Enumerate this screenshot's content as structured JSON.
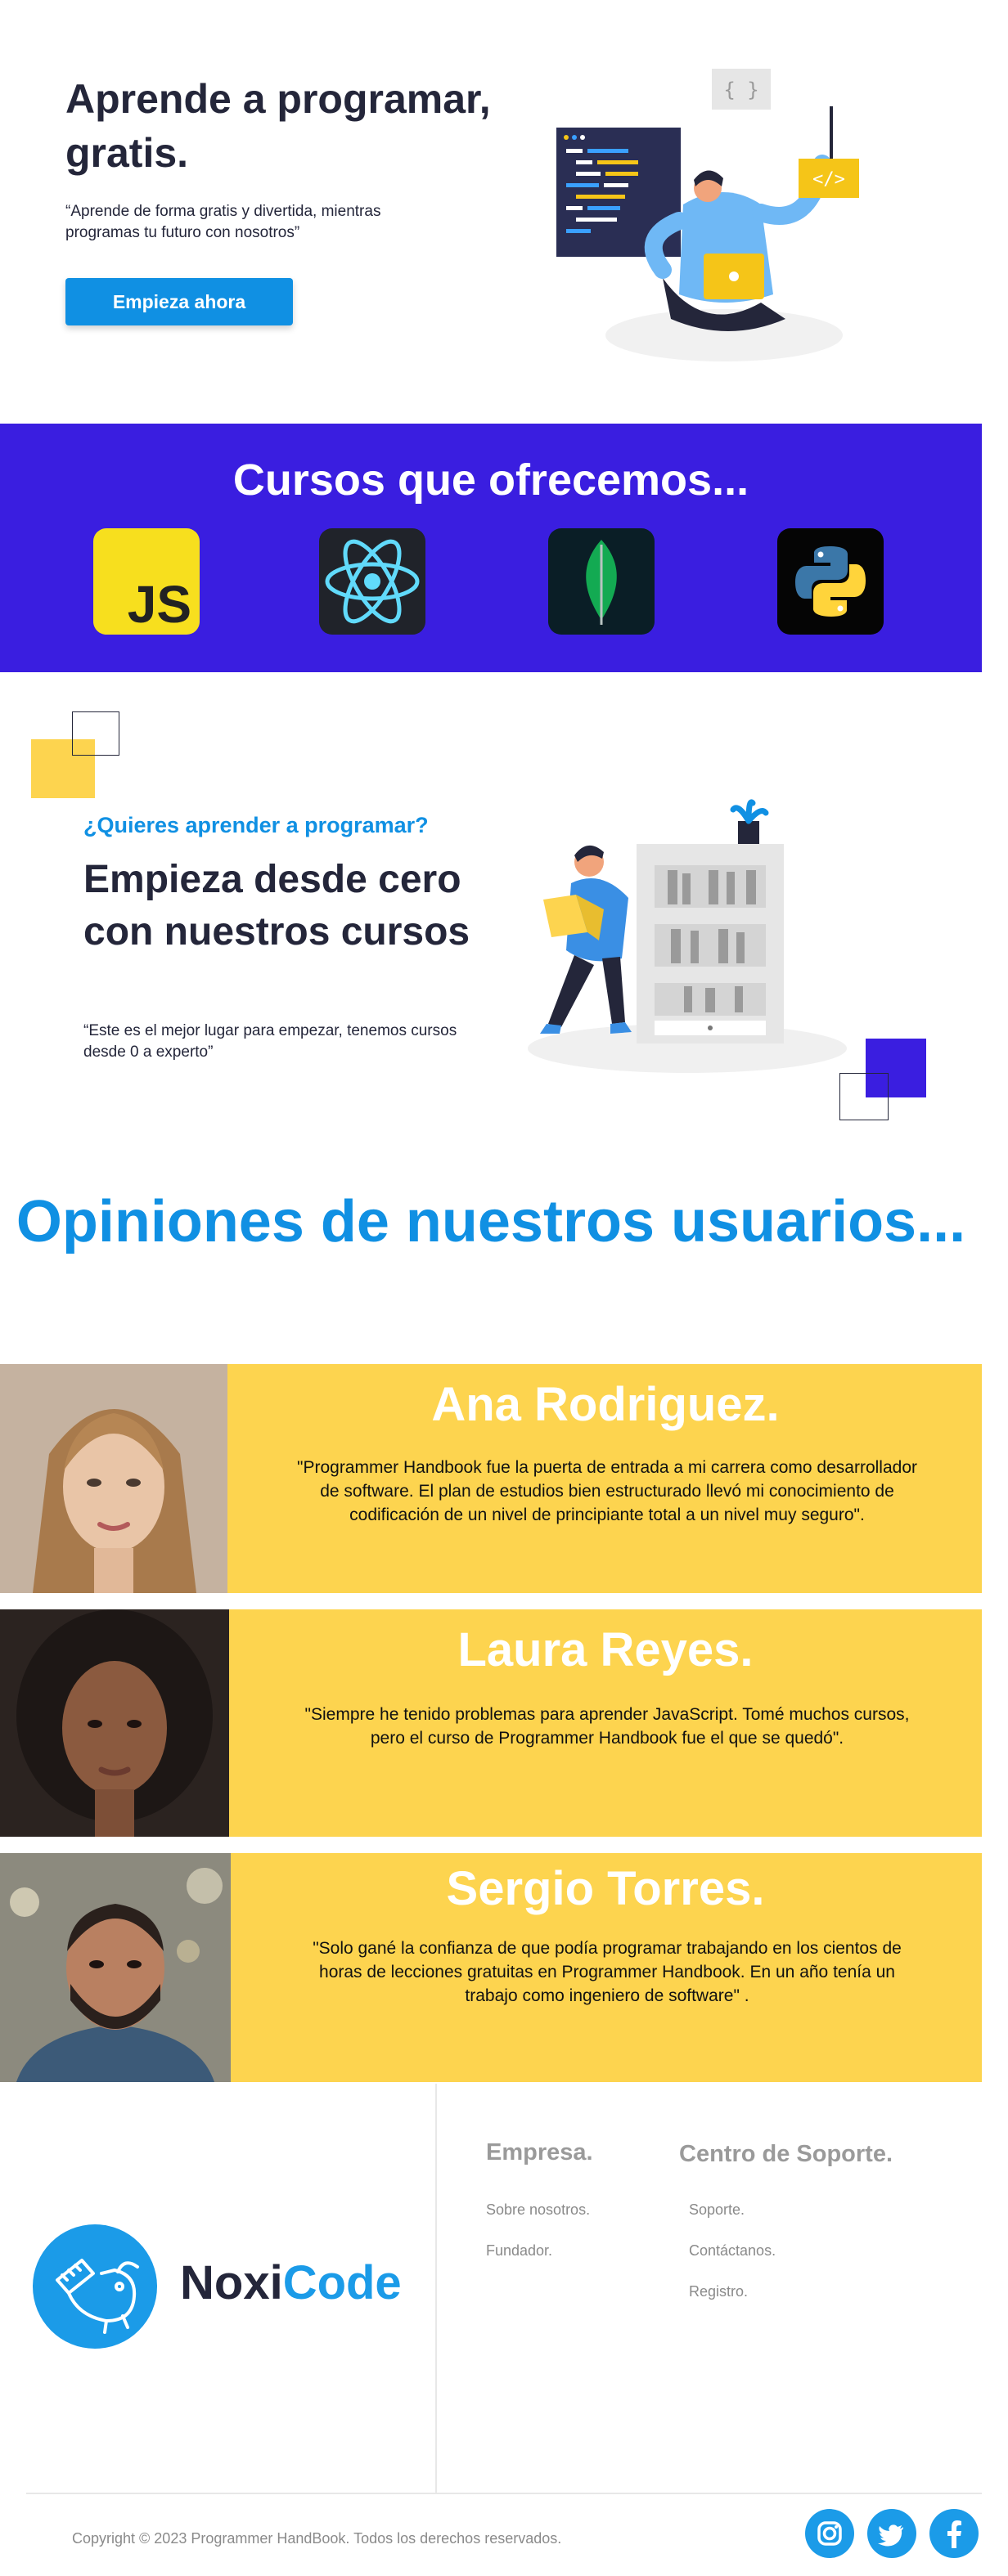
{
  "hero": {
    "title": "Aprende a programar, gratis.",
    "quote": "“Aprende de forma gratis y divertida, mientras programas tu futuro con nosotros”",
    "cta": "Empieza ahora",
    "illustration_icon": "programmer-laptop-illustration"
  },
  "courses": {
    "title": "Cursos que ofrecemos...",
    "items": [
      {
        "icon": "javascript-logo-icon",
        "text": "JS"
      },
      {
        "icon": "react-logo-icon"
      },
      {
        "icon": "mongodb-logo-icon"
      },
      {
        "icon": "python-logo-icon"
      }
    ]
  },
  "learn": {
    "kicker": "¿Quieres aprender a programar?",
    "title": "Empieza desde cero con nuestros cursos",
    "quote": "“Este es el mejor lugar para empezar, tenemos cursos desde 0 a experto”",
    "illustration_icon": "bookshelf-reader-illustration"
  },
  "opinions": {
    "title": "Opiniones de nuestros usuarios...",
    "items": [
      {
        "name": "Ana Rodriguez.",
        "quote": "\"Programmer Handbook fue la puerta de entrada a mi carrera como desarrollador de software. El plan de estudios bien estructurado llevó mi conocimiento de codificación de un nivel de principiante total a un nivel muy seguro\"."
      },
      {
        "name": "Laura Reyes.",
        "quote": "\"Siempre he tenido problemas para aprender JavaScript. Tomé muchos cursos, pero el curso de Programmer Handbook fue el que se quedó\"."
      },
      {
        "name": "Sergio Torres.",
        "quote": "\"Solo gané la confianza de que podía programar trabajando en los cientos de horas de lecciones gratuitas en Programmer Handbook. En un año tenía un trabajo como ingeniero de software\" ."
      }
    ]
  },
  "footer": {
    "brand": {
      "part1": "Noxi",
      "part2": "Code"
    },
    "company": {
      "title": "Empresa.",
      "links": [
        "Sobre nosotros.",
        "Fundador."
      ]
    },
    "support": {
      "title": "Centro de Soporte.",
      "links": [
        "Soporte.",
        "Contáctanos.",
        "Registro."
      ]
    },
    "copyright": "Copyright © 2023 Programmer HandBook. Todos los derechos reservados.",
    "social": [
      "instagram-icon",
      "twitter-icon",
      "facebook-icon"
    ]
  },
  "colors": {
    "primary_blue": "#1090e3",
    "courses_bg": "#3a1ee0",
    "testimonial_bg": "#fdd44f",
    "dark_text": "#24263a"
  }
}
